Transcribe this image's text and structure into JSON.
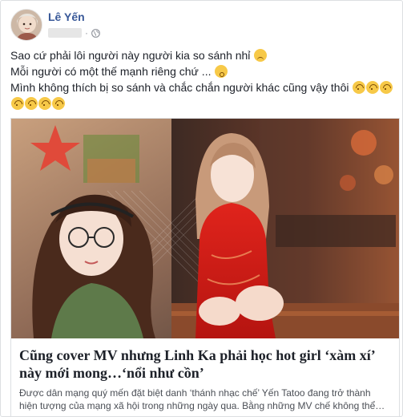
{
  "post": {
    "author": "Lê Yến",
    "status_lines": [
      "Sao cứ phải lôi người này người kia so sánh nhỉ",
      "Mỗi người có một thế mạnh riêng chứ ...",
      "Mình không thích bị so sánh và chắc chắn người khác cũng vậy thôi"
    ],
    "emojis": {
      "line1": "disappointed-face",
      "line2": "kissing-face",
      "line3": [
        "upside-down-face",
        "upside-down-face",
        "upside-down-face"
      ],
      "line4": [
        "upside-down-face",
        "upside-down-face",
        "upside-down-face",
        "upside-down-face"
      ]
    },
    "privacy_icon": "globe-icon"
  },
  "link": {
    "title": "Cũng cover MV nhưng Linh Ka phải học hot girl ‘xàm xí’ này mới mong…‘nổi như cồn’",
    "description_line1": "Được dân mạng quý mến đặt biệt danh ‘thánh nhạc chế’ Yến Tatoo đang trở thành",
    "description_line2": "hiện tượng của mạng xã hội trong những ngày qua. Bằng những MV chế không thể…"
  },
  "colors": {
    "author": "#385898",
    "text": "#1d2129",
    "border": "#dddfe2"
  }
}
